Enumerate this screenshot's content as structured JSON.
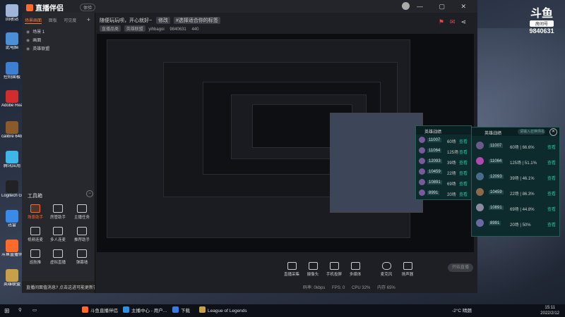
{
  "desktop_icons": [
    {
      "label": "回收站",
      "color": "#9fb6d8"
    },
    {
      "label": "此电脑",
      "color": "#4a8fd8"
    },
    {
      "label": "控制面板",
      "color": "#3d7fd0"
    },
    {
      "label": "Adobe Reader X",
      "color": "#d22c2c"
    },
    {
      "label": "calibre 64bit - E-book ...",
      "color": "#8a5a2a"
    },
    {
      "label": "腾讯应用",
      "color": "#3fb6e8"
    },
    {
      "label": "Logitech G HUB",
      "color": "#222222"
    },
    {
      "label": "迅雷",
      "color": "#3a8be8"
    },
    {
      "label": "斗鱼直播伴侣",
      "color": "#ff6a2b"
    },
    {
      "label": "英雄联盟",
      "color": "#c8a04a"
    }
  ],
  "app": {
    "logo": "直播伴侣",
    "version_badge": "体验",
    "window_controls": "— ▢ ✕",
    "header": {
      "title": "随便玩玩呗，开心就好~",
      "edit_pill": "修改",
      "tag": "#选择适合你的标签",
      "category_pill": "直播品类",
      "game_pill": "英雄联盟",
      "room_name": "yihbagoi",
      "room_id": "9840631",
      "viewers": "440"
    },
    "left_panel": {
      "tabs": [
        "场景画面",
        "面板",
        "可见度"
      ],
      "add_icon": "+",
      "scenes": [
        "场景 1",
        "画面",
        "英雄联盟"
      ],
      "tools_title": "工具箱",
      "tools": [
        {
          "label": "场景助手",
          "active": true
        },
        {
          "label": "房管助手",
          "active": false
        },
        {
          "label": "主播任务",
          "active": false
        },
        {
          "label": "视频连麦",
          "active": false
        },
        {
          "label": "多人连麦",
          "active": false
        },
        {
          "label": "推荐助手",
          "active": false
        },
        {
          "label": "巡航推",
          "active": false
        },
        {
          "label": "虚拟直播",
          "active": false
        },
        {
          "label": "弹幕墙",
          "active": false
        }
      ],
      "notice": "直播间面值消息? 点击这进可能更新答疑"
    },
    "bottom_buttons": [
      "直播采集",
      "摄像头",
      "手机投屏",
      "多媒体",
      "麦克风",
      "扬声器"
    ],
    "start_live": "开始直播",
    "status_items": [
      "码率: 0kbps",
      "FPS: 0",
      "CPU 32%",
      "内存 65%"
    ]
  },
  "room_badge": {
    "logo": "斗鱼",
    "label": "房间号",
    "number": "9840631"
  },
  "rank_panel_large": {
    "title": "英雄战绩",
    "search_placeholder": "请输入召唤师名",
    "rows": [
      {
        "score": "11007",
        "games": "60场 | 66.6%",
        "action": "查看"
      },
      {
        "score": "11064",
        "games": "125场 | 51.1%",
        "action": "查看"
      },
      {
        "score": "12093",
        "games": "39场 | 46.1%",
        "action": "查看"
      },
      {
        "score": "10459",
        "games": "22场 | 86.3%",
        "action": "查看"
      },
      {
        "score": "10891",
        "games": "69场 | 44.8%",
        "action": "查看"
      },
      {
        "score": "8991",
        "games": "20场 | 50%",
        "action": "查看"
      }
    ]
  },
  "rank_panel_small": {
    "title": "英雄战绩",
    "rows": [
      {
        "score": "11007",
        "games": "60场",
        "action": "查看"
      },
      {
        "score": "11064",
        "games": "125场",
        "action": "查看"
      },
      {
        "score": "12093",
        "games": "39场",
        "action": "查看"
      },
      {
        "score": "10459",
        "games": "22场",
        "action": "查看"
      },
      {
        "score": "10891",
        "games": "69场",
        "action": "查看"
      },
      {
        "score": "8991",
        "games": "20场",
        "action": "查看"
      }
    ]
  },
  "taskbar": {
    "items": [
      {
        "label": "斗鱼直播伴侣",
        "color": "#ff6a2b"
      },
      {
        "label": "主播中心 - 用户...",
        "color": "#2f8fe0"
      },
      {
        "label": "下载",
        "color": "#3a7be0"
      },
      {
        "label": "League of Legends",
        "color": "#c8a04a"
      }
    ],
    "weather": "-2°C 晴朗",
    "time": "15:11",
    "date": "2022/2/12"
  }
}
